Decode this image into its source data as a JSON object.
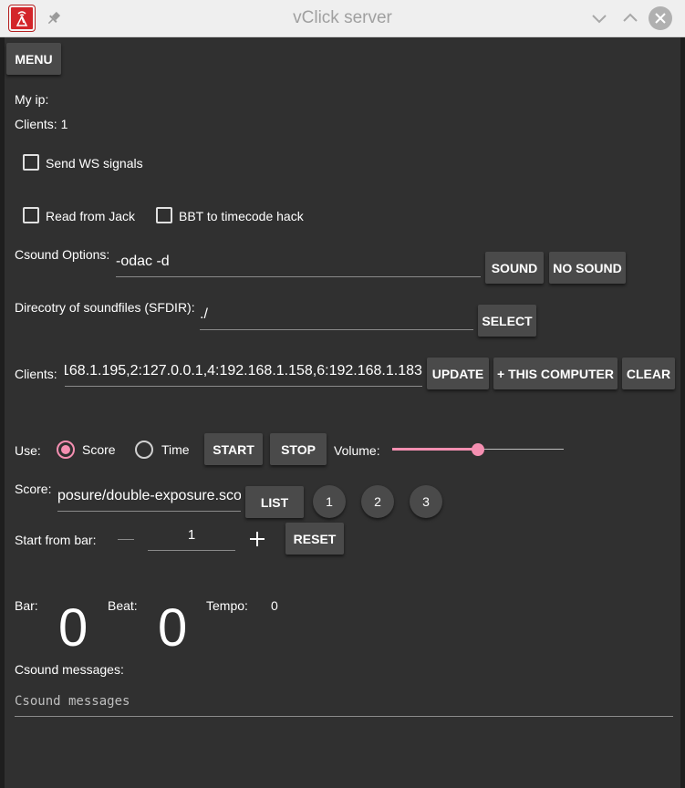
{
  "window": {
    "title": "vClick server",
    "icon": "app-icon",
    "controls": [
      "pin-icon",
      "minimize-icon",
      "maximize-icon",
      "close-icon"
    ]
  },
  "menu_button": "MENU",
  "my_ip_label": "My ip:",
  "clients_count": "Clients: 1",
  "send_ws_signals": {
    "label": "Send WS signals",
    "checked": false
  },
  "read_from_jack": {
    "label": "Read from Jack",
    "checked": false
  },
  "bbt_to_timecode": {
    "label": "BBT to timecode hack",
    "checked": false
  },
  "csound_options": {
    "label": "Csound Options:",
    "value": "-odac -d",
    "sound_button": "SOUND",
    "no_sound_button": "NO SOUND"
  },
  "sfdir": {
    "label": "Direcotry of soundfiles (SFDIR):",
    "value": "./",
    "select_button": "SELECT"
  },
  "clients": {
    "label": "Clients:",
    "value": "168.1.195,2:127.0.0.1,4:192.168.1.158,6:192.168.1.183",
    "update_button": "UPDATE",
    "this_computer_button": "+ THIS COMPUTER",
    "clear_button": "CLEAR"
  },
  "use": {
    "label": "Use:",
    "score_option": "Score",
    "time_option": "Time",
    "selected": "Score",
    "start_button": "START",
    "stop_button": "STOP",
    "volume_label": "Volume:",
    "volume_level": 0.5,
    "accent_color": "#f48fb1"
  },
  "score": {
    "label": "Score:",
    "value": "posure/double-exposure.sco",
    "list_button": "LIST",
    "preset_buttons": [
      "1",
      "2",
      "3"
    ]
  },
  "start_bar": {
    "label": "Start from bar:",
    "value": "1",
    "reset_button": "RESET"
  },
  "status": {
    "bar_label": "Bar:",
    "bar_value": "0",
    "beat_label": "Beat:",
    "beat_value": "0",
    "tempo_label": "Tempo:",
    "tempo_value": "0"
  },
  "csound_messages": {
    "label": "Csound messages:",
    "placeholder": "Csound messages"
  }
}
